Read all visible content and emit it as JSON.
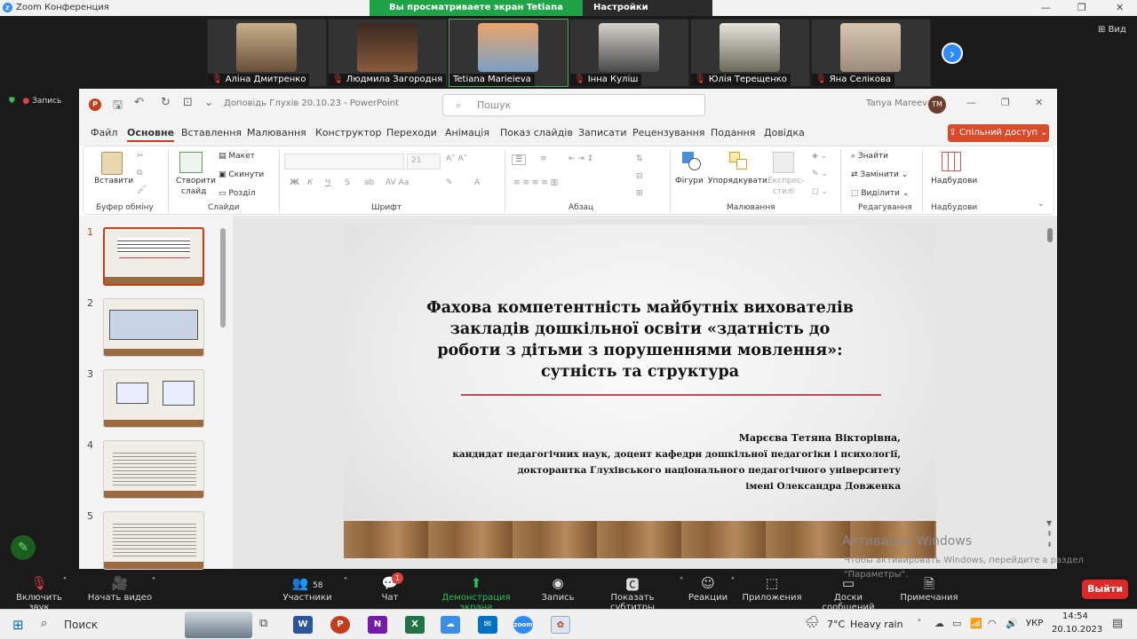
{
  "zoom": {
    "window_title": "Zoom Конференция",
    "banner": "Вы просматриваете экран Tetiana Marieieva",
    "view_options": "Настройки просмотра",
    "view_label": "Вид",
    "recording": "Запись"
  },
  "participants": [
    {
      "name": "Аліна Дмитренко",
      "muted": true
    },
    {
      "name": "Людмила Загородня",
      "muted": true
    },
    {
      "name": "Tetiana Marieieva",
      "muted": false
    },
    {
      "name": "Інна Куліш",
      "muted": true
    },
    {
      "name": "Юлія Терещенко",
      "muted": true
    },
    {
      "name": "Яна Селікова",
      "muted": true
    }
  ],
  "ppt": {
    "doc_title": "Доповідь Глухів 20.10.23 - PowerPoint",
    "search_placeholder": "Пошук",
    "user": "Tanya Mareeva",
    "user_initials": "TM",
    "menu": [
      "Файл",
      "Основне",
      "Вставлення",
      "Малювання",
      "Конструктор",
      "Переходи",
      "Анімація",
      "Показ слайдів",
      "Записати",
      "Рецензування",
      "Подання",
      "Довідка"
    ],
    "active_menu": "Основне",
    "share": "Спільний доступ",
    "ribbon": {
      "paste": "Вставити",
      "clipboard": "Буфер обміну",
      "new_slide_l1": "Створити",
      "new_slide_l2": "слайд",
      "layout": "Макет",
      "reset": "Скинути",
      "section": "Розділ",
      "slides": "Слайди",
      "font_size": "21",
      "font": "Шрифт",
      "paragraph": "Абзац",
      "shapes": "Фігури",
      "arrange": "Упорядкувати",
      "quick_styles_l1": "Експрес-",
      "quick_styles_l2": "стилі",
      "drawing": "Малювання",
      "find": "Знайти",
      "replace": "Замінити",
      "select": "Виділити",
      "editing": "Редагування",
      "addins": "Надбудови",
      "addins_group": "Надбудови"
    },
    "thumbnails": [
      "1",
      "2",
      "3",
      "4",
      "5"
    ],
    "slide": {
      "title_lines": [
        "Фахова компетентність майбутніх вихователів",
        "закладів дошкільної освіти «здатність до",
        "роботи з дітьми з порушеннями мовлення»:",
        "сутність та структура"
      ],
      "author_lines": [
        "Марєєва Тетяна Вікторівна,",
        "кандидат педагогічних наук, доцент кафедри дошкільної педагогіки і психології,",
        "докторантка Глухівського національного педагогічного університету",
        "імені Олександра Довженка"
      ]
    }
  },
  "activation": {
    "title": "Активация Windows",
    "sub": "Чтобы активировать Windows, перейдите в раздел \"Параметры\"."
  },
  "toolbar": {
    "unmute": "Включить звук",
    "video": "Начать видео",
    "participants": "Участники",
    "participants_count": "58",
    "chat": "Чат",
    "chat_badge": "1",
    "share": "Демонстрация экрана",
    "record": "Запись",
    "captions": "Показать субтитры",
    "reactions": "Реакции",
    "apps": "Приложения",
    "whiteboards": "Доски сообщений",
    "notes": "Примечания",
    "leave": "Выйти"
  },
  "taskbar": {
    "search": "Поиск",
    "weather_temp": "7°C",
    "weather_text": "Heavy rain",
    "lang": "УКР",
    "time": "14:54",
    "date": "20.10.2023"
  }
}
